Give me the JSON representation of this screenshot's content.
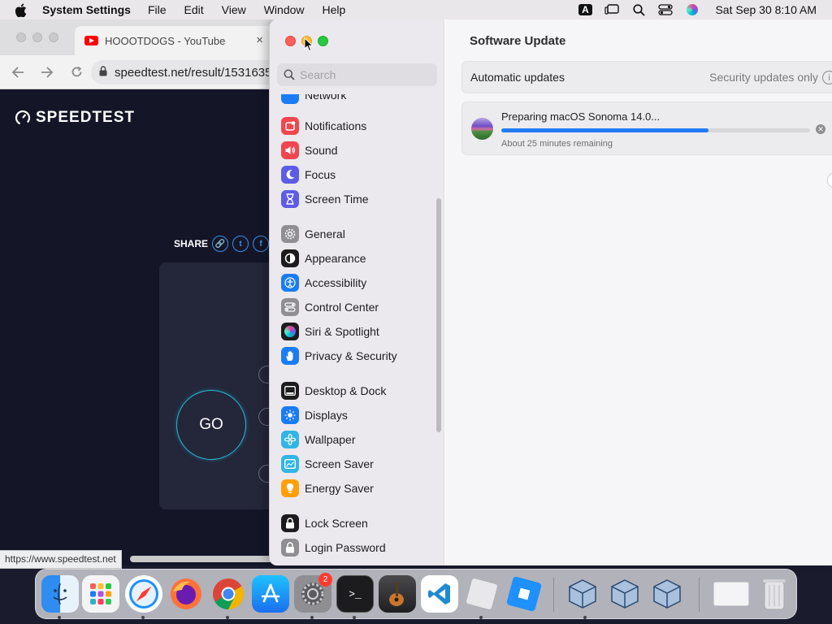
{
  "menubar": {
    "app_name": "System Settings",
    "menus": [
      "File",
      "Edit",
      "View",
      "Window",
      "Help"
    ],
    "input_source": "A",
    "clock": "Sat Sep 30  8:10 AM"
  },
  "browser": {
    "tab_title": "HOOOTDOGS - YouTube",
    "tab_close": "×",
    "url": "speedtest.net/result/1531635",
    "logo_text": "SPEEDTEST",
    "share_label": "SHARE",
    "go_label": "GO",
    "status_url": "https://www.speedtest.net"
  },
  "settings": {
    "search_placeholder": "Search",
    "sidebar_partial_item": "Network",
    "sidebar_items": [
      {
        "label": "Notifications",
        "icon": "bell-icon",
        "color": "#f2454d"
      },
      {
        "label": "Sound",
        "icon": "speaker-icon",
        "color": "#f2454d"
      },
      {
        "label": "Focus",
        "icon": "moon-icon",
        "color": "#5e5ce6"
      },
      {
        "label": "Screen Time",
        "icon": "hourglass-icon",
        "color": "#5e5ce6"
      },
      {
        "label": "General",
        "icon": "gear-icon",
        "color": "#8e8e93"
      },
      {
        "label": "Appearance",
        "icon": "appearance-icon",
        "color": "#1c1c1e"
      },
      {
        "label": "Accessibility",
        "icon": "accessibility-icon",
        "color": "#1a7cf5"
      },
      {
        "label": "Control Center",
        "icon": "switches-icon",
        "color": "#8e8e93"
      },
      {
        "label": "Siri & Spotlight",
        "icon": "siri-icon",
        "color": "#b44ad8"
      },
      {
        "label": "Privacy & Security",
        "icon": "hand-icon",
        "color": "#1a7cf5"
      },
      {
        "label": "Desktop & Dock",
        "icon": "dock-icon",
        "color": "#1c1c1e"
      },
      {
        "label": "Displays",
        "icon": "sun-icon",
        "color": "#1a7cf5"
      },
      {
        "label": "Wallpaper",
        "icon": "flower-icon",
        "color": "#33b5e5"
      },
      {
        "label": "Screen Saver",
        "icon": "screensaver-icon",
        "color": "#33b5e5"
      },
      {
        "label": "Energy Saver",
        "icon": "bulb-icon",
        "color": "#ff9f0a"
      },
      {
        "label": "Lock Screen",
        "icon": "lock-icon",
        "color": "#1c1c1e"
      },
      {
        "label": "Login Password",
        "icon": "padlock-icon",
        "color": "#8e8e93"
      }
    ],
    "content": {
      "title": "Software Update",
      "automatic_updates_label": "Automatic updates",
      "automatic_updates_value": "Security updates only",
      "update_title": "Preparing macOS Sonoma 14.0...",
      "update_progress": 0.67,
      "update_remaining": "About 25 minutes remaining",
      "help_label": "?"
    }
  },
  "dock": {
    "apps": [
      "Finder",
      "Launchpad",
      "Safari",
      "Firefox",
      "Google Chrome",
      "App Store",
      "System Settings",
      "Terminal",
      "GarageBand",
      "Visual Studio Code",
      "Roblox",
      "Roblox Studio",
      "VirtualBox",
      "VirtualBox",
      "VirtualBox",
      "Screenshot",
      "Trash"
    ],
    "settings_badge": "2"
  }
}
